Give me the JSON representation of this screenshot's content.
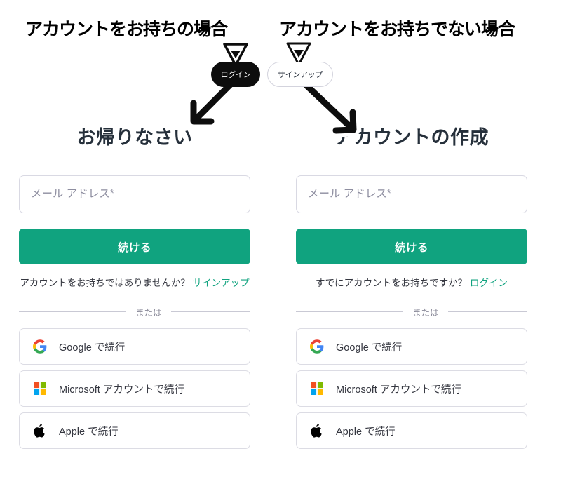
{
  "annotations": {
    "left_heading": "アカウントをお持ちの場合",
    "right_heading": "アカウントをお持ちでない場合",
    "login_pill": "ログイン",
    "signup_pill": "サインアップ",
    "marker_icon": "triangle-down-icon",
    "arrow_left_icon": "arrow-down-left-icon",
    "arrow_right_icon": "arrow-down-right-icon"
  },
  "colors": {
    "accent_green": "#10a37f",
    "heading": "#26303b",
    "body_text": "#353740",
    "placeholder": "#8e8ea0",
    "border": "#d9d9e3",
    "annotation_black": "#0d0d0d"
  },
  "login_panel": {
    "title": "お帰りなさい",
    "email_placeholder": "メール アドレス*",
    "email_value": "",
    "continue_label": "続ける",
    "switch_prompt": "アカウントをお持ちではありませんか？",
    "switch_link": "サインアップ",
    "divider_label": "または",
    "social": [
      {
        "id": "google",
        "icon": "google-icon",
        "label": "Google で続行"
      },
      {
        "id": "microsoft",
        "icon": "microsoft-icon",
        "label": "Microsoft アカウントで続行"
      },
      {
        "id": "apple",
        "icon": "apple-icon",
        "label": "Apple で続行"
      }
    ]
  },
  "signup_panel": {
    "title": "アカウントの作成",
    "email_placeholder": "メール アドレス*",
    "email_value": "",
    "continue_label": "続ける",
    "switch_prompt": "すでにアカウントをお持ちですか？",
    "switch_link": "ログイン",
    "divider_label": "または",
    "social": [
      {
        "id": "google",
        "icon": "google-icon",
        "label": "Google で続行"
      },
      {
        "id": "microsoft",
        "icon": "microsoft-icon",
        "label": "Microsoft アカウントで続行"
      },
      {
        "id": "apple",
        "icon": "apple-icon",
        "label": "Apple で続行"
      }
    ]
  }
}
